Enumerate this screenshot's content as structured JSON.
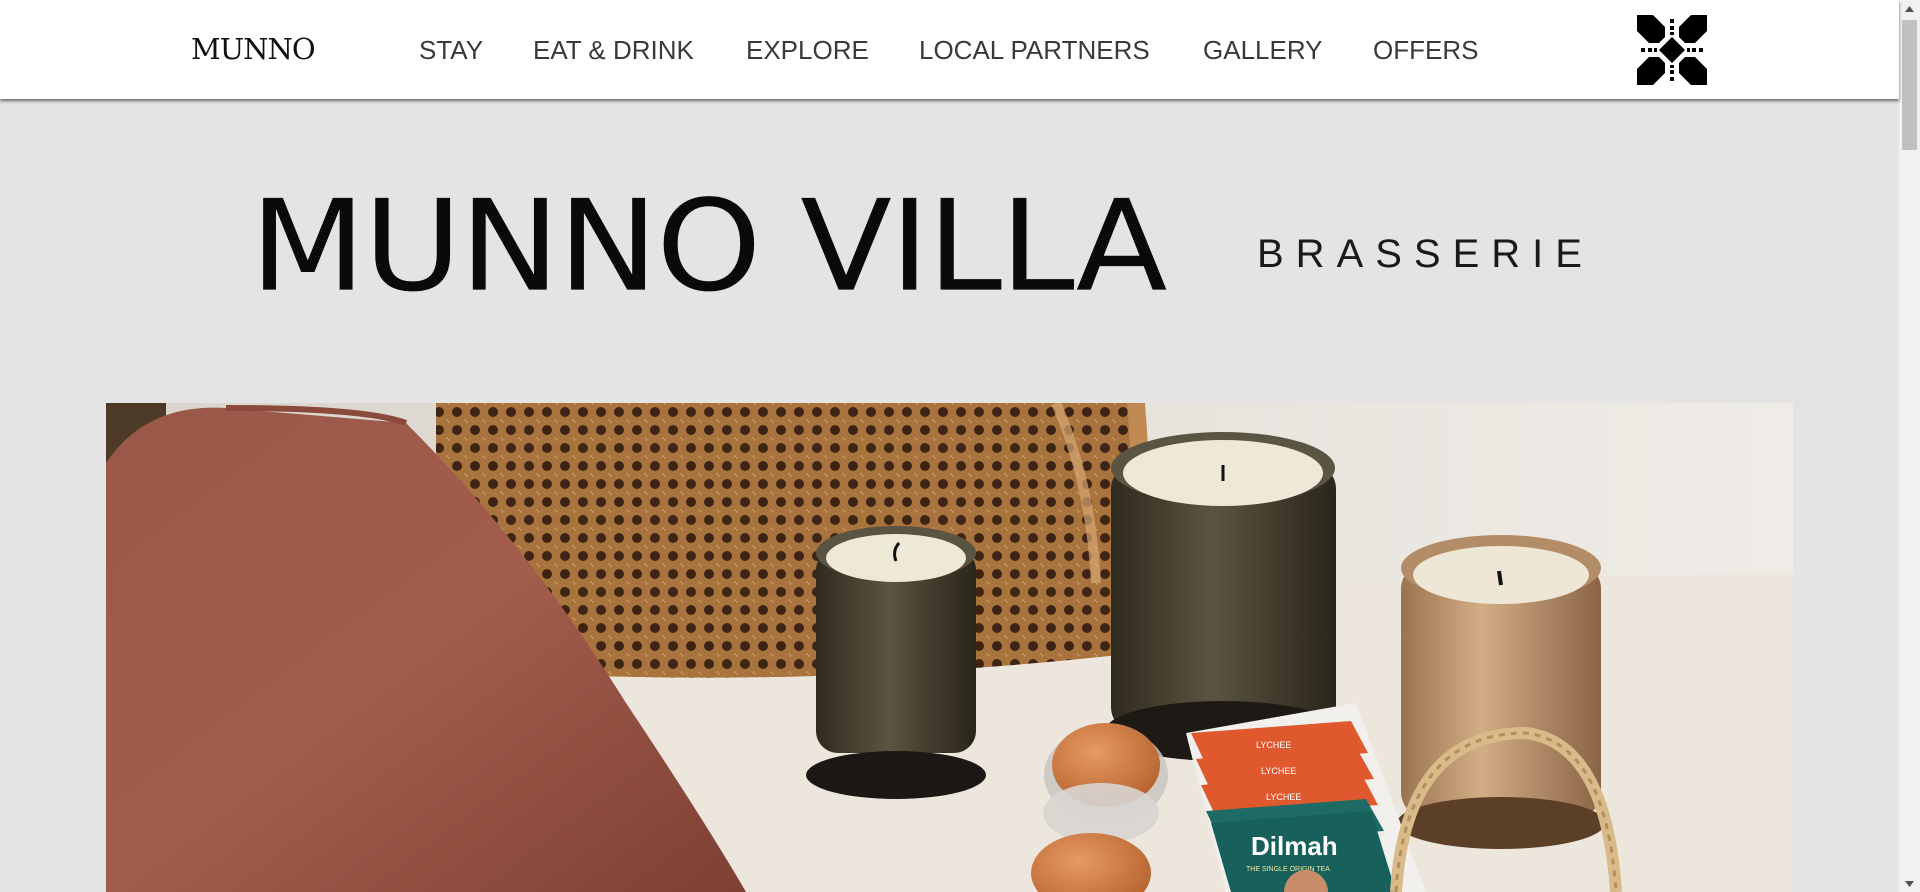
{
  "nav": {
    "logo": "MUNNO",
    "items": [
      {
        "label": "STAY"
      },
      {
        "label": "EAT & DRINK"
      },
      {
        "label": "EXPLORE"
      },
      {
        "label": "LOCAL PARTNERS"
      },
      {
        "label": "GALLERY"
      },
      {
        "label": "OFFERS"
      }
    ],
    "emblem_icon": "munno-emblem-icon"
  },
  "hero": {
    "title": "MUNNO VILLA",
    "subtitle": "BRASSERIE"
  },
  "photo": {
    "tea_brand": "Dilmah",
    "tea_line": "THE SINGLE ORIGIN TEA",
    "tea_label": "LYCHEE"
  },
  "colors": {
    "page_background": "#e4e4e4",
    "navbar_background": "#ffffff",
    "text_dark": "#0a0a0a",
    "nav_text": "#3a3a3a"
  }
}
